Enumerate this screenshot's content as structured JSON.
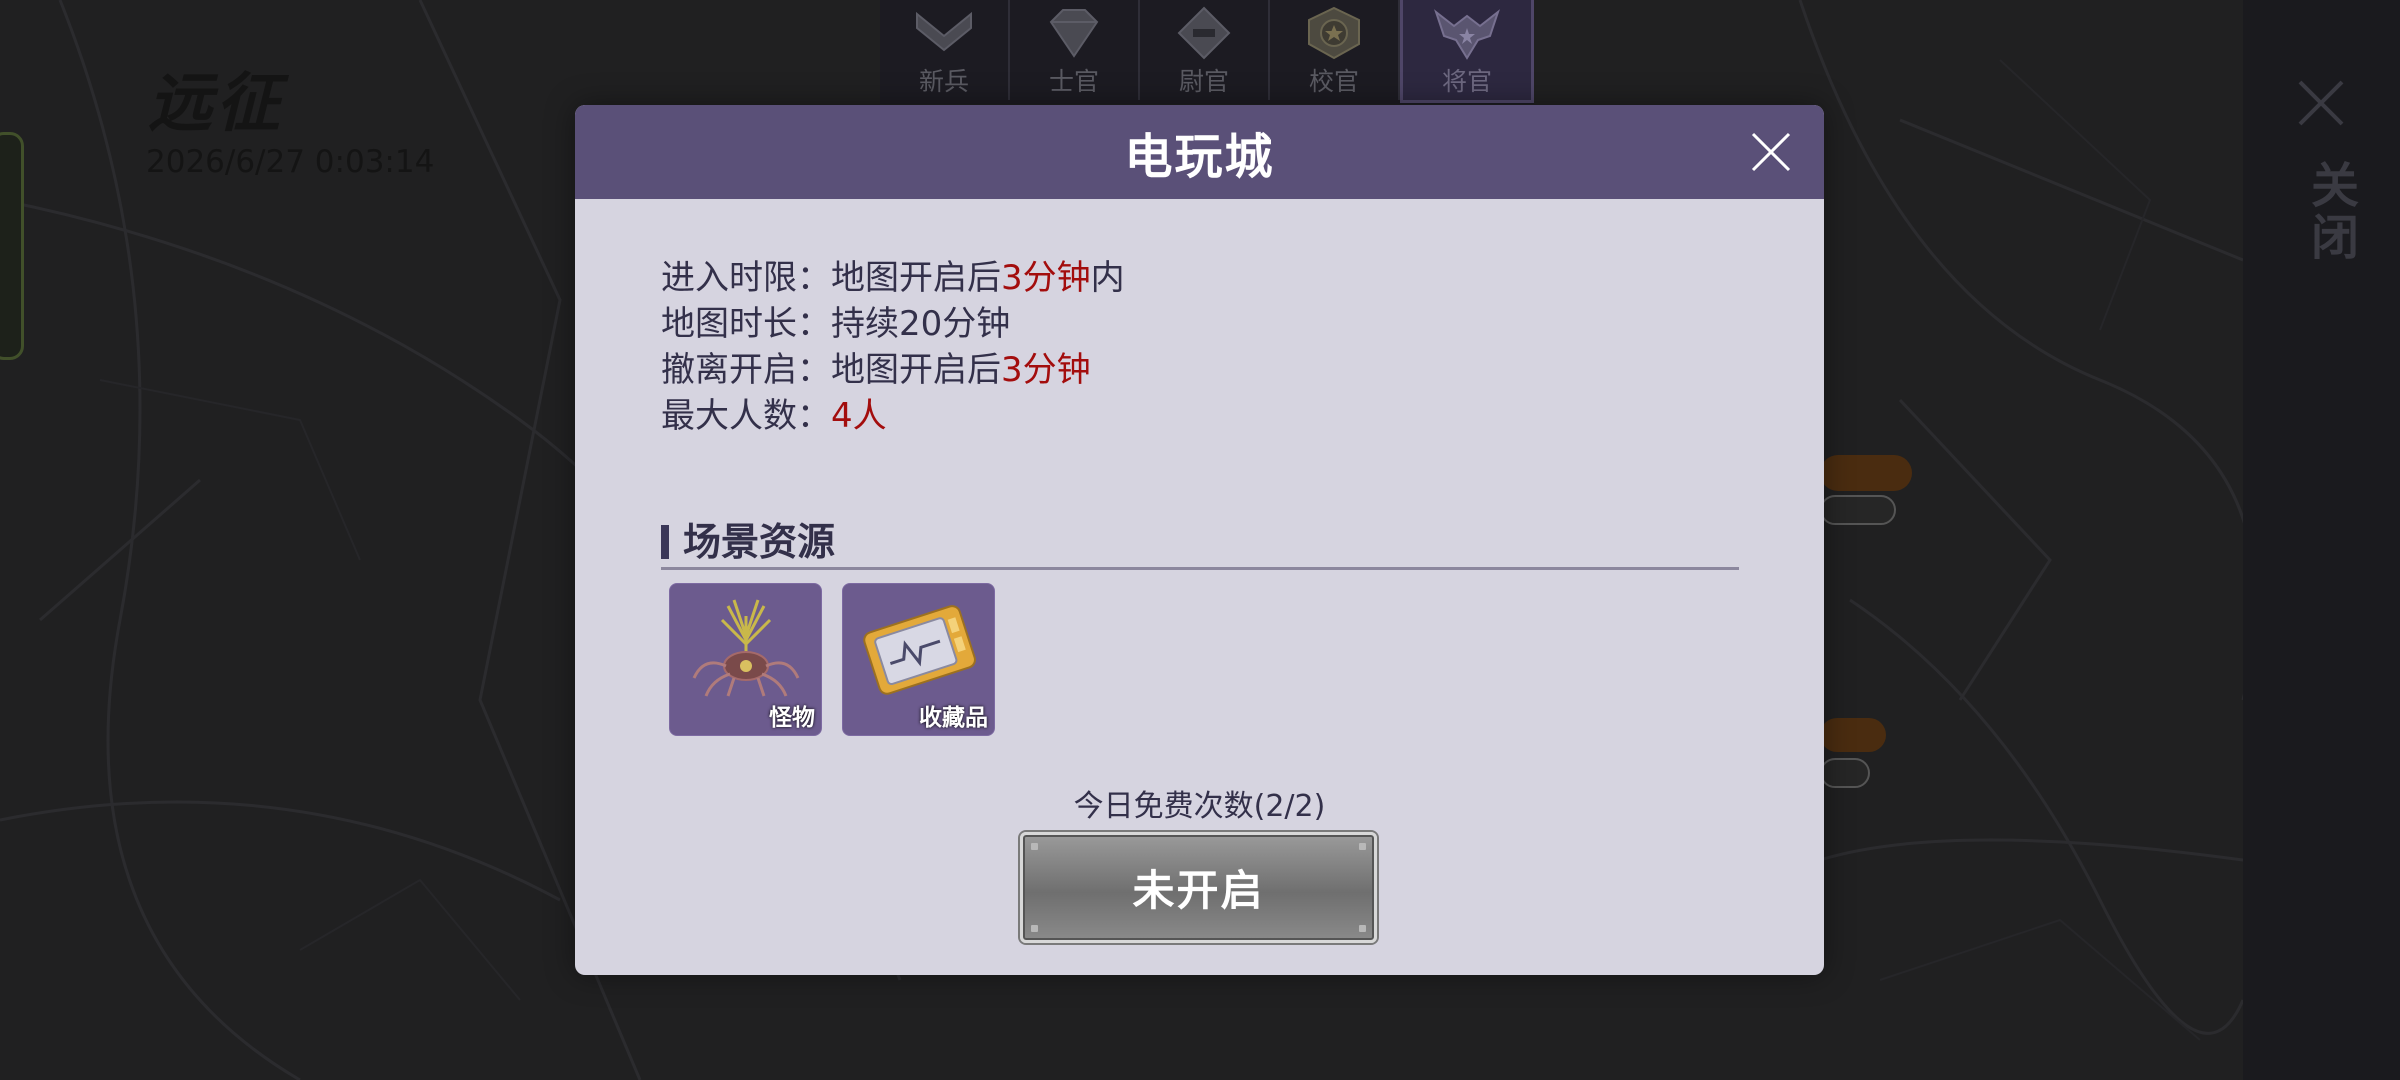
{
  "page": {
    "title": "远征",
    "datetime": "2026/6/27 0:03:14"
  },
  "rank_tabs": [
    {
      "label": "新兵",
      "icon": "chevron-emblem-icon"
    },
    {
      "label": "士官",
      "icon": "diamond-emblem-icon"
    },
    {
      "label": "尉官",
      "icon": "bar-diamond-emblem-icon"
    },
    {
      "label": "校官",
      "icon": "star-emblem-icon"
    },
    {
      "label": "将官",
      "icon": "eagle-emblem-icon",
      "selected": true
    }
  ],
  "side_panel": {
    "close_label": "关闭"
  },
  "dialog": {
    "title": "电玩城",
    "info": [
      {
        "label": "进入时限：",
        "pre": "地图开启后",
        "highlight": "3分钟",
        "post": "内"
      },
      {
        "label": "地图时长：",
        "pre": "持续20分钟",
        "highlight": "",
        "post": ""
      },
      {
        "label": "撤离开启：",
        "pre": "地图开启后",
        "highlight": "3分钟",
        "post": ""
      },
      {
        "label": "最大人数：",
        "pre": "",
        "highlight": "4人",
        "post": ""
      }
    ],
    "section_title": "场景资源",
    "resources": [
      {
        "label": "怪物",
        "icon": "monster-icon"
      },
      {
        "label": "收藏品",
        "icon": "collectible-device-icon"
      }
    ],
    "free_count": "今日免费次数(2/2)",
    "button_label": "未开启",
    "colors": {
      "header": "#5a5078",
      "body": "#d6d4e0",
      "highlight": "#a30d0d",
      "item_bg": "#6c5b8e"
    }
  }
}
